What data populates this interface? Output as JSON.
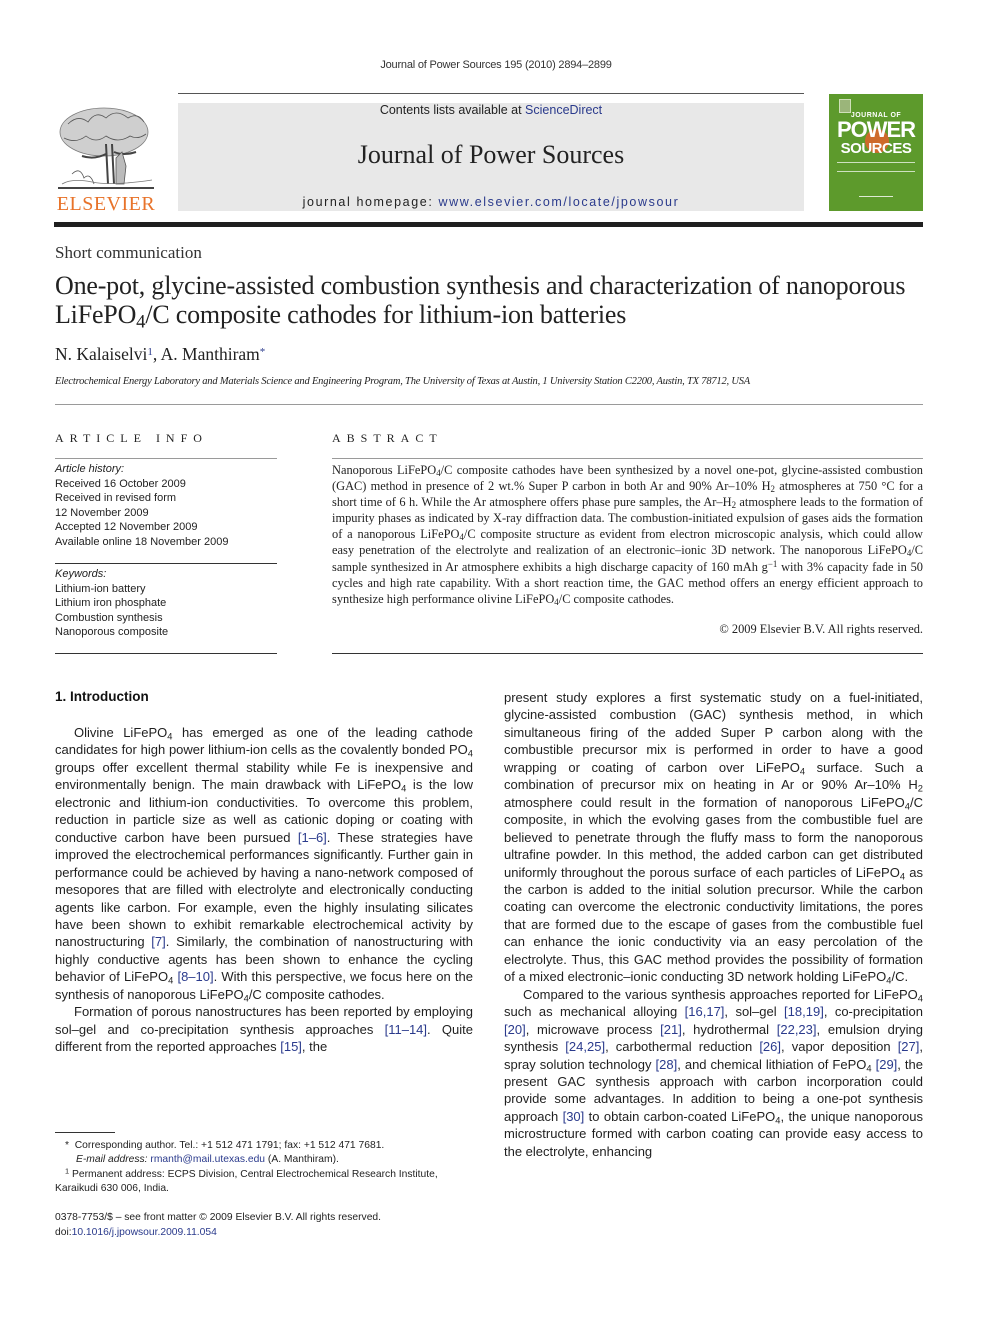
{
  "running_head": "Journal of Power Sources 195 (2010) 2894–2899",
  "masthead": {
    "contents_prefix": "Contents lists available at ",
    "contents_link": "ScienceDirect",
    "journal_title": "Journal of Power Sources",
    "homepage_prefix": "journal homepage: ",
    "homepage_link": "www.elsevier.com/locate/jpowsour",
    "publisher": "ELSEVIER",
    "publisher_color": "#e8732a",
    "cover": {
      "line1": "JOURNAL OF",
      "line2": "POWER",
      "line3": "SOURCES",
      "color": "#5d9a2c"
    }
  },
  "article": {
    "section_type": "Short communication",
    "title_part1": "One-pot, glycine-assisted combustion synthesis and characterization of nanoporous LiFePO",
    "title_sub": "4",
    "title_part2": "/C composite cathodes for lithium-ion batteries",
    "authors": [
      {
        "name": "N. Kalaiselvi",
        "mark": "1"
      },
      {
        "name": "A. Manthiram",
        "mark": "*"
      }
    ],
    "affiliation": "Electrochemical Energy Laboratory and Materials Science and Engineering Program, The University of Texas at Austin, 1 University Station C2200, Austin, TX 78712, USA"
  },
  "article_info": {
    "heading": "ARTICLE INFO",
    "history_label": "Article history:",
    "history": [
      "Received 16 October 2009",
      "Received in revised form",
      "12 November 2009",
      "Accepted 12 November 2009",
      "Available online 18 November 2009"
    ],
    "keywords_label": "Keywords:",
    "keywords": [
      "Lithium-ion battery",
      "Lithium iron phosphate",
      "Combustion synthesis",
      "Nanoporous composite"
    ]
  },
  "abstract": {
    "heading": "ABSTRACT",
    "segments": [
      "Nanoporous LiFePO",
      "4",
      "/C composite cathodes have been synthesized by a novel one-pot, glycine-assisted combustion (GAC) method in presence of 2 wt.% Super P carbon in both Ar and 90% Ar–10% H",
      "2",
      " atmospheres at 750 °C for a short time of 6 h. While the Ar atmosphere offers phase pure samples, the Ar–H",
      "2",
      " atmosphere leads to the formation of impurity phases as indicated by X-ray diffraction data. The combustion-initiated expulsion of gases aids the formation of a nanoporous LiFePO",
      "4",
      "/C composite structure as evident from electron microscopic analysis, which could allow easy penetration of the electrolyte and realization of an electronic–ionic 3D network. The nanoporous LiFePO",
      "4",
      "/C sample synthesized in Ar atmosphere exhibits a high discharge capacity of 160 mAh g",
      "−1",
      " with 3% capacity fade in 50 cycles and high rate capability. With a short reaction time, the GAC method offers an energy efficient approach to synthesize high performance olivine LiFePO",
      "4",
      "/C composite cathodes."
    ],
    "copyright": "© 2009 Elsevier B.V. All rights reserved."
  },
  "intro": {
    "heading": "1.  Introduction",
    "p1": [
      "Olivine LiFePO",
      "4",
      " has emerged as one of the leading cathode candidates for high power lithium-ion cells as the covalently bonded PO",
      "4",
      " groups offer excellent thermal stability while Fe is inexpensive and environmentally benign. The main drawback with LiFePO",
      "4",
      " is the low electronic and lithium-ion conductivities. To overcome this problem, reduction in particle size as well as cationic doping or coating with conductive carbon have been pursued ",
      "[1–6]",
      ". These strategies have improved the electrochemical performances significantly. Further gain in performance could be achieved by having a nano-network composed of mesopores that are filled with electrolyte and electronically conducting agents like carbon. For example, even the highly insulating silicates have been shown to exhibit remarkable electrochemical activity by nanostructuring ",
      "[7]",
      ". Similarly, the combination of nanostructuring with highly conductive agents has been shown to enhance the cycling behavior of LiFePO",
      "4",
      " ",
      "[8–10]",
      ". With this perspective, we focus here on the synthesis of nanoporous LiFePO",
      "4",
      "/C composite cathodes."
    ],
    "p2": [
      "Formation of porous nanostructures has been reported by employing sol–gel and co-precipitation synthesis approaches ",
      "[11–14]",
      ". Quite different from the reported approaches ",
      "[15]",
      ", the"
    ],
    "p2_cont": [
      "present study explores a first systematic study on a fuel-initiated, glycine-assisted combustion (GAC) synthesis method, in which simultaneous firing of the added Super P carbon along with the combustible precursor mix is performed in order to have a good wrapping or coating of carbon over LiFePO",
      "4",
      " surface. Such a combination of precursor mix on heating in Ar or 90% Ar–10% H",
      "2",
      " atmosphere could result in the formation of nanoporous LiFePO",
      "4",
      "/C composite, in which the evolving gases from the combustible fuel are believed to penetrate through the fluffy mass to form the nanoporous ultrafine powder. In this method, the added carbon can get distributed uniformly throughout the porous surface of each particles of LiFePO",
      "4",
      " as the carbon is added to the initial solution precursor. While the carbon coating can overcome the electronic conductivity limitations, the pores that are formed due to the escape of gases from the combustible fuel can enhance the ionic conductivity via an easy percolation of the electrolyte. Thus, this GAC method provides the possibility of formation of a mixed electronic–ionic conducting 3D network holding LiFePO",
      "4",
      "/C."
    ],
    "p3": [
      "Compared to the various synthesis approaches reported for LiFePO",
      "4",
      " such as mechanical alloying ",
      "[16,17]",
      ", sol–gel ",
      "[18,19]",
      ", co-precipitation ",
      "[20]",
      ", microwave process ",
      "[21]",
      ", hydrothermal ",
      "[22,23]",
      ", emulsion drying synthesis ",
      "[24,25]",
      ", carbothermal reduction ",
      "[26]",
      ", vapor deposition ",
      "[27]",
      ", spray solution technology ",
      "[28]",
      ", and chemical lithiation of FePO",
      "4",
      " ",
      "[29]",
      ", the present GAC synthesis approach with carbon incorporation could provide some advantages. In addition to being a one-pot synthesis approach ",
      "[30]",
      " to obtain carbon-coated LiFePO",
      "4",
      ", the unique nanoporous microstructure formed with carbon coating can provide easy access to the electrolyte, enhancing"
    ]
  },
  "footnotes": {
    "corr_mark": "*",
    "corr_text": "Corresponding author. Tel.: +1 512 471 1791; fax: +1 512 471 7681.",
    "email_label": "E-mail address:",
    "email": "rmanth@mail.utexas.edu",
    "email_suffix": "(A. Manthiram).",
    "perm_mark": "1",
    "perm_text": "Permanent address: ECPS Division, Central Electrochemical Research Institute, Karaikudi 630 006, India."
  },
  "issn_line": "0378-7753/$ – see front matter © 2009 Elsevier B.V. All rights reserved.",
  "doi_prefix": "doi:",
  "doi": "10.1016/j.jpowsour.2009.11.054"
}
